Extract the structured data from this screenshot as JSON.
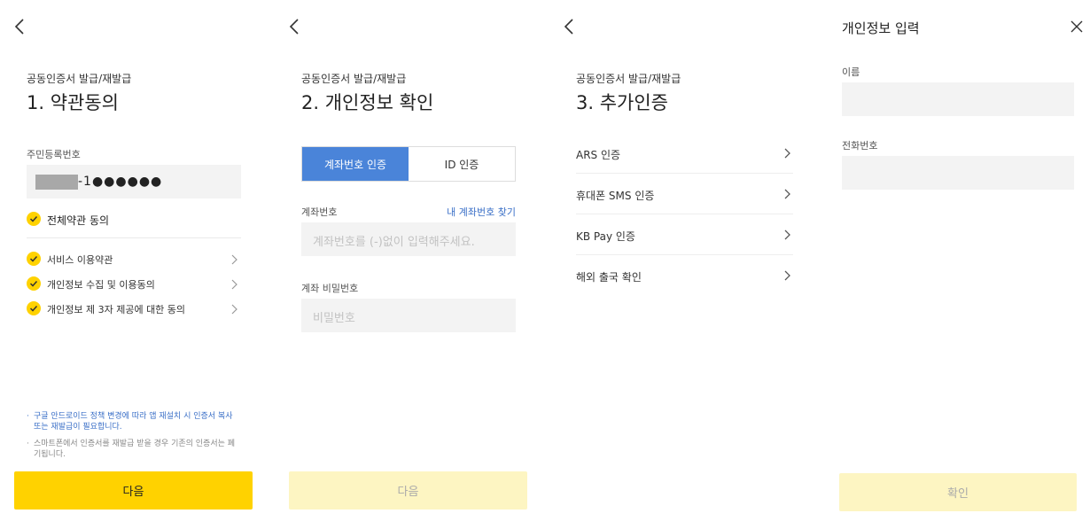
{
  "screen1": {
    "subtitle": "공동인증서 발급/재발급",
    "title": "1. 약관동의",
    "id_label": "주민등록번호",
    "id_value": "-1●●●●●●",
    "agree_all": "전체약관 동의",
    "agreements": [
      {
        "label": "서비스 이용약관"
      },
      {
        "label": "개인정보 수집 및 이용동의"
      },
      {
        "label": "개인정보 제 3자 제공에 대한 동의"
      }
    ],
    "notice_1": "구글 안드로이드 정책 변경에 따라 앱 재설치 시 인증서 복사 또는 재발급이 필요합니다.",
    "notice_2": "스마트폰에서 인증서를 재발급 받을 경우 기존의 인증서는 폐기됩니다.",
    "next_label": "다음"
  },
  "screen2": {
    "subtitle": "공동인증서 발급/재발급",
    "title": "2. 개인정보 확인",
    "tab_account": "계좌번호 인증",
    "tab_id": "ID 인증",
    "account_label": "계좌번호",
    "find_account_link": "내 계좌번호 찾기",
    "account_placeholder": "계좌번호를 (-)없이 입력해주세요.",
    "password_label": "계좌 비밀번호",
    "password_placeholder": "비밀번호",
    "next_label": "다음"
  },
  "screen3": {
    "subtitle": "공동인증서 발급/재발급",
    "title": "3. 추가인증",
    "methods": [
      {
        "label": "ARS 인증"
      },
      {
        "label": "휴대폰 SMS 인증"
      },
      {
        "label": "KB Pay 인증"
      },
      {
        "label": "해외 출국 확인"
      }
    ]
  },
  "screen4": {
    "title": "개인정보 입력",
    "name_label": "이름",
    "phone_label": "전화번호",
    "confirm_label": "확인"
  },
  "colors": {
    "accent_yellow": "#ffd200",
    "disabled_yellow": "#fdf5c2",
    "tab_blue": "#4a84d9",
    "link_blue": "#3a6fc7"
  },
  "icons": [
    "back-arrow-icon",
    "check-icon",
    "chevron-right-icon",
    "close-icon"
  ]
}
